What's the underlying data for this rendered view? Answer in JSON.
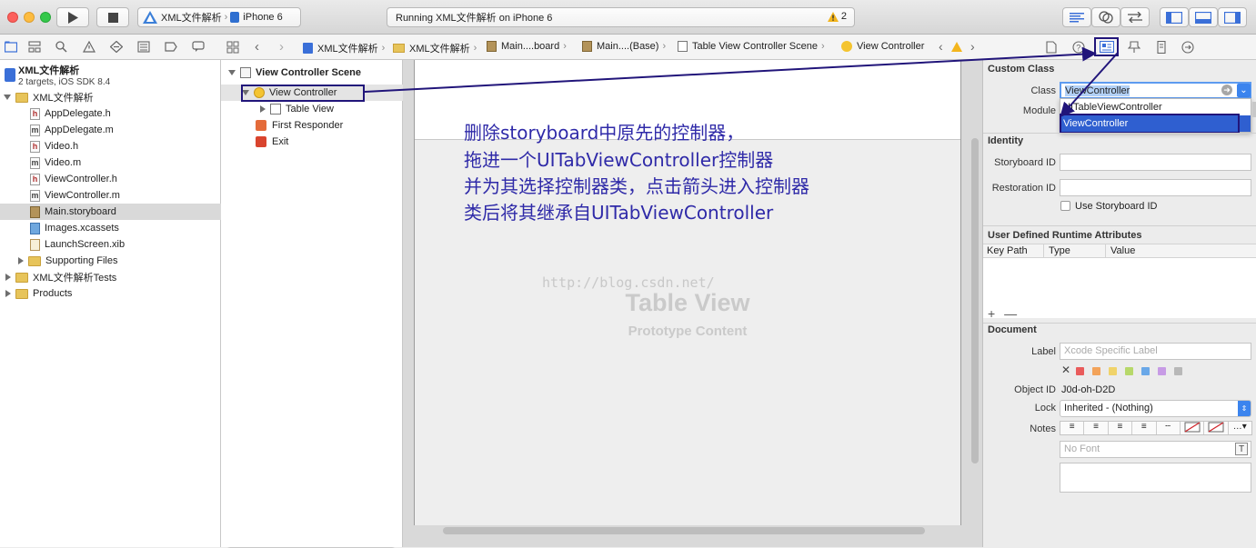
{
  "toolbar": {
    "scheme": "XML文件解析",
    "device": "iPhone 6",
    "status": "Running XML文件解析 on iPhone 6",
    "warning_count": "2"
  },
  "jumpbar": {
    "crumbs": [
      "XML文件解析",
      "XML文件解析",
      "Main....board",
      "Main....(Base)",
      "Table View Controller Scene",
      "View Controller"
    ]
  },
  "navigator": {
    "project_name": "XML文件解析",
    "project_subtitle": "2 targets, iOS SDK 8.4",
    "group": "XML文件解析",
    "files": [
      {
        "name": "AppDelegate.h",
        "type": "h"
      },
      {
        "name": "AppDelegate.m",
        "type": "m"
      },
      {
        "name": "Video.h",
        "type": "h"
      },
      {
        "name": "Video.m",
        "type": "m"
      },
      {
        "name": "ViewController.h",
        "type": "h"
      },
      {
        "name": "ViewController.m",
        "type": "m"
      },
      {
        "name": "Main.storyboard",
        "type": "storyboard"
      },
      {
        "name": "Images.xcassets",
        "type": "assets"
      },
      {
        "name": "LaunchScreen.xib",
        "type": "xib"
      }
    ],
    "supporting": "Supporting Files",
    "tests": "XML文件解析Tests",
    "products": "Products"
  },
  "outline": {
    "scene": "View Controller Scene",
    "controller": "View Controller",
    "table_view": "Table View",
    "first_responder": "First Responder",
    "exit": "Exit"
  },
  "canvas": {
    "annotation": [
      "删除storyboard中原先的控制器，",
      "拖进一个UITabViewController控制器",
      "并为其选择控制器类，点击箭头进入控制器",
      "类后将其继承自UITabViewController"
    ],
    "watermark": "http://blog.csdn.net/",
    "table_view": "Table View",
    "prototype": "Prototype Content"
  },
  "inspector": {
    "custom_class": "Custom Class",
    "class_label": "Class",
    "class_value": "ViewController",
    "module_label": "Module",
    "dropdown_options": [
      "UITableViewController",
      "ViewController"
    ],
    "identity": "Identity",
    "storyboard_id_label": "Storyboard ID",
    "restoration_id_label": "Restoration ID",
    "use_storyboard_id": "Use Storyboard ID",
    "udra": "User Defined Runtime Attributes",
    "col_keypath": "Key Path",
    "col_type": "Type",
    "col_value": "Value",
    "add_remove": "+ —",
    "document": "Document",
    "label_label": "Label",
    "label_placeholder": "Xcode Specific Label",
    "object_id_label": "Object ID",
    "object_id_value": "J0d-oh-D2D",
    "lock_label": "Lock",
    "lock_value": "Inherited - (Nothing)",
    "notes_label": "Notes",
    "font_placeholder": "No Font",
    "colors": [
      "#e95b5b",
      "#f3a35a",
      "#f0d36a",
      "#b7d86a",
      "#6aa8e8",
      "#c79be5",
      "#b8b8b8"
    ]
  }
}
